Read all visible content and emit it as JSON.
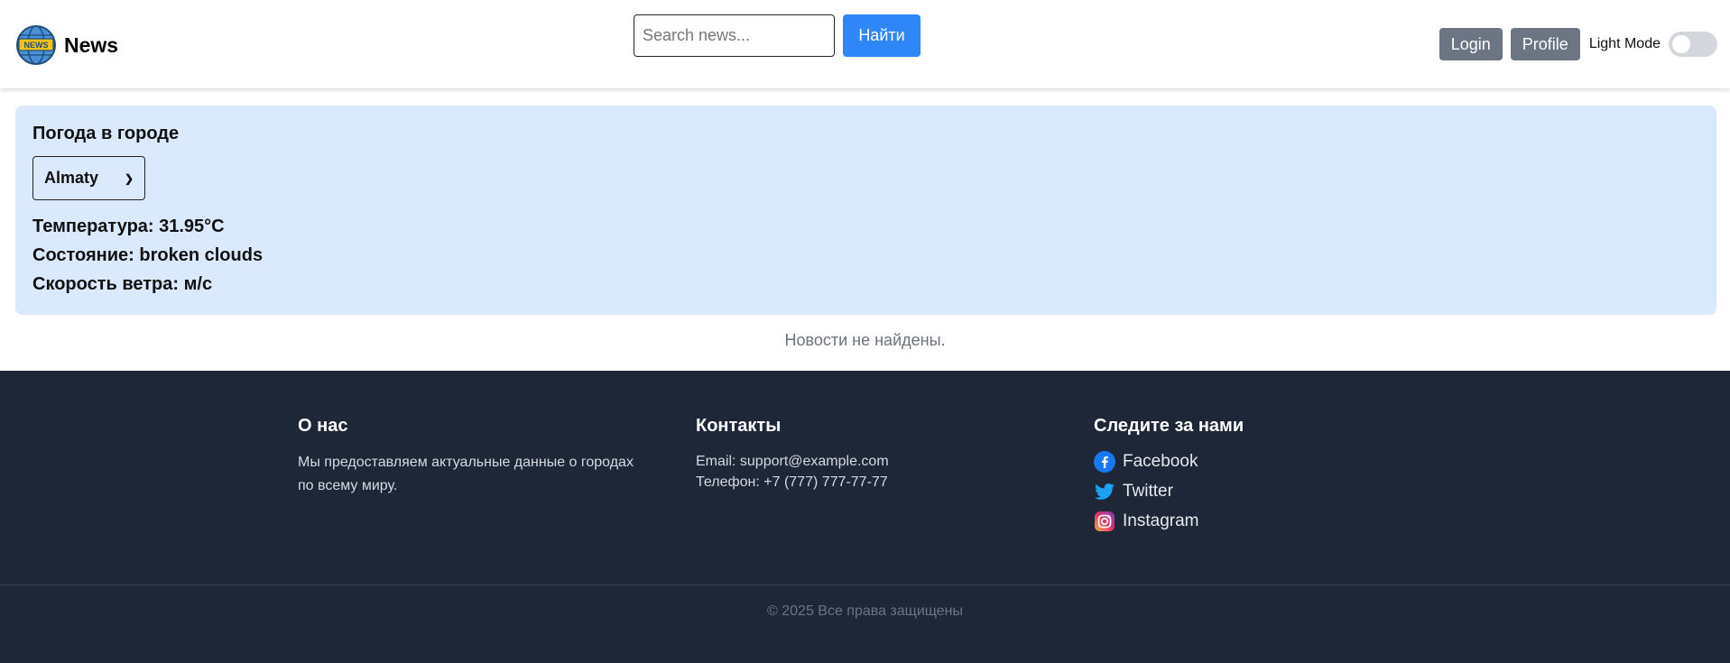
{
  "header": {
    "brand": "News",
    "logo_badge": "NEWS",
    "search_placeholder": "Search news...",
    "search_button": "Найти",
    "login_label": "Login",
    "profile_label": "Profile",
    "mode_label": "Light Mode",
    "mode_enabled": false
  },
  "weather": {
    "title": "Погода в городе",
    "selected_city": "Almaty",
    "temperature": "Температура: 31.95°C",
    "condition": "Состояние: broken clouds",
    "wind": "Скорость ветра: м/с"
  },
  "news": {
    "empty_message": "Новости не найдены."
  },
  "footer": {
    "about_title": "О нас",
    "about_text": "Мы предоставляем актуальные данные о городах по всему миру.",
    "contacts_title": "Контакты",
    "email": "Email: support@example.com",
    "phone": "Телефон: +7 (777) 777-77-77",
    "follow_title": "Следите за нами",
    "socials": [
      {
        "label": "Facebook",
        "icon": "facebook-icon",
        "color": "#1877f2"
      },
      {
        "label": "Twitter",
        "icon": "twitter-icon",
        "color": "#1da1f2"
      },
      {
        "label": "Instagram",
        "icon": "instagram-icon",
        "color": "#e1306c"
      }
    ],
    "copyright": "© 2025 Все права защищены"
  },
  "colors": {
    "primary": "#2f86f6",
    "secondary_button": "#6c7583",
    "weather_bg": "#dbe9fd",
    "footer_bg": "#1e2737"
  }
}
